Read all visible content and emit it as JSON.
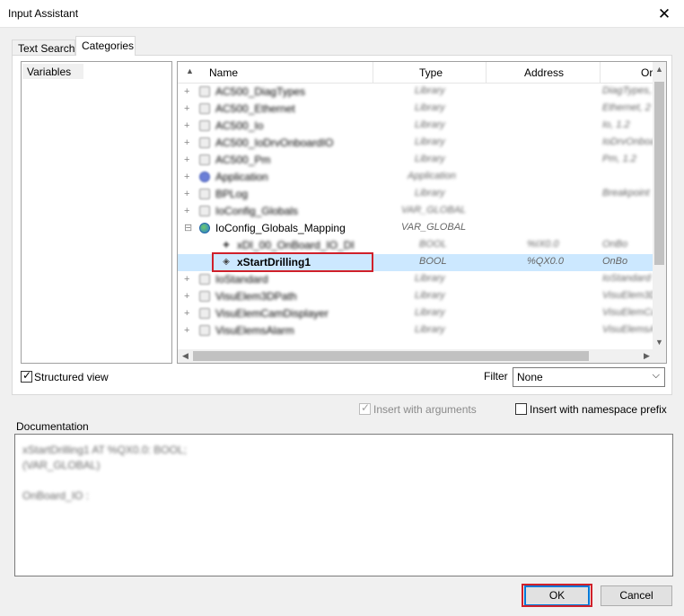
{
  "window": {
    "title": "Input Assistant",
    "close_icon": "close-icon"
  },
  "tabs": [
    {
      "label": "Text Search",
      "active": false
    },
    {
      "label": "Categories",
      "active": true
    }
  ],
  "categories": {
    "items": [
      "Variables"
    ],
    "selected": "Variables"
  },
  "tree": {
    "columns": [
      "Name",
      "Type",
      "Address",
      "Or"
    ],
    "rows": [
      {
        "name": "AC500_DiagTypes",
        "type": "Library",
        "address": "",
        "origin": "DiagTypes, 2",
        "blurred": true,
        "icon": "library-icon"
      },
      {
        "name": "AC500_Ethernet",
        "type": "Library",
        "address": "",
        "origin": "Ethernet, 2",
        "blurred": true,
        "icon": "library-icon"
      },
      {
        "name": "AC500_Io",
        "type": "Library",
        "address": "",
        "origin": "Io, 1.2",
        "blurred": true,
        "icon": "library-icon"
      },
      {
        "name": "AC500_IoDrvOnboardIO",
        "type": "Library",
        "address": "",
        "origin": "IoDrvOnboard",
        "blurred": true,
        "icon": "library-icon"
      },
      {
        "name": "AC500_Pm",
        "type": "Library",
        "address": "",
        "origin": "Pm, 1.2",
        "blurred": true,
        "icon": "library-icon"
      },
      {
        "name": "Application",
        "type": "Application",
        "address": "",
        "origin": "",
        "blurred": true,
        "icon": "application-icon"
      },
      {
        "name": "BPLog",
        "type": "Library",
        "address": "",
        "origin": "Breakpoint",
        "blurred": true,
        "icon": "library-icon"
      },
      {
        "name": "IoConfig_Globals",
        "type": "VAR_GLOBAL",
        "address": "",
        "origin": "",
        "blurred": true,
        "icon": "library-icon"
      },
      {
        "name": "IoConfig_Globals_Mapping",
        "type": "VAR_GLOBAL",
        "address": "",
        "origin": "",
        "blurred": false,
        "icon": "globe-icon",
        "expanded": true
      },
      {
        "name": "xDI_00_OnBoard_IO_DI",
        "type": "BOOL",
        "address": "%IX0.0",
        "origin": "OnBo",
        "blurred": true,
        "icon": "variable-icon",
        "child": true
      },
      {
        "name": "xStartDrilling1",
        "type": "BOOL",
        "address": "%QX0.0",
        "origin": "OnBo",
        "blurred": false,
        "icon": "variable-icon",
        "child": true,
        "selected": true
      },
      {
        "name": "IoStandard",
        "type": "Library",
        "address": "",
        "origin": "IoStandard",
        "blurred": true,
        "icon": "library-icon"
      },
      {
        "name": "VisuElem3DPath",
        "type": "Library",
        "address": "",
        "origin": "VisuElem3D",
        "blurred": true,
        "icon": "library-icon"
      },
      {
        "name": "VisuElemCamDisplayer",
        "type": "Library",
        "address": "",
        "origin": "VisuElemCa",
        "blurred": true,
        "icon": "library-icon"
      },
      {
        "name": "VisuElemsAlarm",
        "type": "Library",
        "address": "",
        "origin": "VisuElemsA",
        "blurred": true,
        "icon": "library-icon"
      }
    ]
  },
  "options": {
    "structured_view": "Structured view",
    "filter_label": "Filter",
    "filter_value": "None",
    "insert_with_arguments": "Insert with arguments",
    "insert_with_namespace_prefix": "Insert with namespace prefix"
  },
  "documentation": {
    "label": "Documentation",
    "lines": [
      "xStartDrilling1 AT %QX0.0: BOOL;",
      "(VAR_GLOBAL)",
      "",
      "OnBoard_IO :"
    ]
  },
  "buttons": {
    "ok": "OK",
    "cancel": "Cancel"
  },
  "colors": {
    "selection": "#cce8ff",
    "highlight_box": "#d0202a",
    "accent": "#0078d7"
  }
}
